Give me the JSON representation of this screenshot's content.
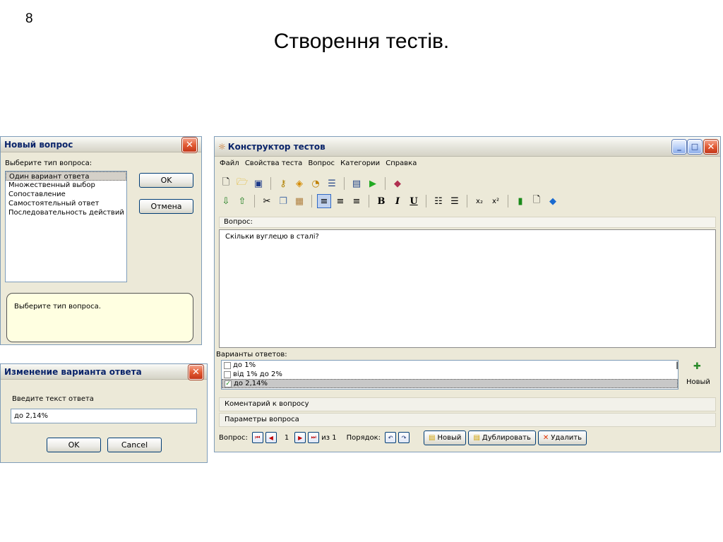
{
  "slide": {
    "number": "8",
    "title": "Створення тестів."
  },
  "new_question": {
    "title": "Новый вопрос",
    "prompt": "Выберите тип вопроса:",
    "types": [
      "Один вариант ответа",
      "Множественный выбор",
      "Сопоставление",
      "Самостоятельный ответ",
      "Последовательность действий"
    ],
    "ok": "OK",
    "cancel": "Отмена",
    "hint": "Выберите тип вопроса."
  },
  "edit_answer": {
    "title": "Изменение варианта ответа",
    "prompt": "Введите текст ответа",
    "value": "до 2,14%",
    "ok": "OK",
    "cancel": "Cancel"
  },
  "main": {
    "title": "Конструктор тестов",
    "menu": [
      "Файл",
      "Свойства теста",
      "Вопрос",
      "Категории",
      "Справка"
    ],
    "question_label": "Вопрос:",
    "question_text": "Скільки вуглецю в сталі?",
    "answers_label": "Варианты ответов:",
    "answers": [
      {
        "text": "до 1%",
        "checked": false
      },
      {
        "text": "від 1% до 2%",
        "checked": false
      },
      {
        "text": "до 2,14%",
        "checked": true
      }
    ],
    "new_answer": "Новый",
    "comment": "Коментарий к вопросу",
    "params": "Параметры вопроса",
    "nav": {
      "label": "Вопрос:",
      "current": "1",
      "of": "из 1",
      "order": "Порядок:"
    },
    "new_btn": "Новый",
    "dup_btn": "Дублировать",
    "del_btn": "Удалить"
  }
}
